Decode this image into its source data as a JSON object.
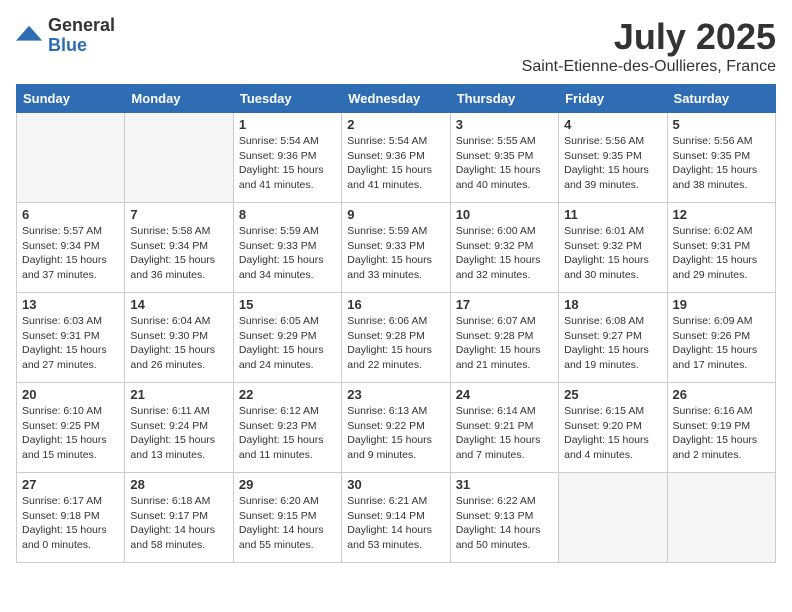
{
  "header": {
    "logo_general": "General",
    "logo_blue": "Blue",
    "month": "July 2025",
    "location": "Saint-Etienne-des-Oullieres, France"
  },
  "weekdays": [
    "Sunday",
    "Monday",
    "Tuesday",
    "Wednesday",
    "Thursday",
    "Friday",
    "Saturday"
  ],
  "weeks": [
    [
      {
        "day": "",
        "empty": true
      },
      {
        "day": "",
        "empty": true
      },
      {
        "day": "1",
        "info": "Sunrise: 5:54 AM\nSunset: 9:36 PM\nDaylight: 15 hours\nand 41 minutes."
      },
      {
        "day": "2",
        "info": "Sunrise: 5:54 AM\nSunset: 9:36 PM\nDaylight: 15 hours\nand 41 minutes."
      },
      {
        "day": "3",
        "info": "Sunrise: 5:55 AM\nSunset: 9:35 PM\nDaylight: 15 hours\nand 40 minutes."
      },
      {
        "day": "4",
        "info": "Sunrise: 5:56 AM\nSunset: 9:35 PM\nDaylight: 15 hours\nand 39 minutes."
      },
      {
        "day": "5",
        "info": "Sunrise: 5:56 AM\nSunset: 9:35 PM\nDaylight: 15 hours\nand 38 minutes."
      }
    ],
    [
      {
        "day": "6",
        "info": "Sunrise: 5:57 AM\nSunset: 9:34 PM\nDaylight: 15 hours\nand 37 minutes."
      },
      {
        "day": "7",
        "info": "Sunrise: 5:58 AM\nSunset: 9:34 PM\nDaylight: 15 hours\nand 36 minutes."
      },
      {
        "day": "8",
        "info": "Sunrise: 5:59 AM\nSunset: 9:33 PM\nDaylight: 15 hours\nand 34 minutes."
      },
      {
        "day": "9",
        "info": "Sunrise: 5:59 AM\nSunset: 9:33 PM\nDaylight: 15 hours\nand 33 minutes."
      },
      {
        "day": "10",
        "info": "Sunrise: 6:00 AM\nSunset: 9:32 PM\nDaylight: 15 hours\nand 32 minutes."
      },
      {
        "day": "11",
        "info": "Sunrise: 6:01 AM\nSunset: 9:32 PM\nDaylight: 15 hours\nand 30 minutes."
      },
      {
        "day": "12",
        "info": "Sunrise: 6:02 AM\nSunset: 9:31 PM\nDaylight: 15 hours\nand 29 minutes."
      }
    ],
    [
      {
        "day": "13",
        "info": "Sunrise: 6:03 AM\nSunset: 9:31 PM\nDaylight: 15 hours\nand 27 minutes."
      },
      {
        "day": "14",
        "info": "Sunrise: 6:04 AM\nSunset: 9:30 PM\nDaylight: 15 hours\nand 26 minutes."
      },
      {
        "day": "15",
        "info": "Sunrise: 6:05 AM\nSunset: 9:29 PM\nDaylight: 15 hours\nand 24 minutes."
      },
      {
        "day": "16",
        "info": "Sunrise: 6:06 AM\nSunset: 9:28 PM\nDaylight: 15 hours\nand 22 minutes."
      },
      {
        "day": "17",
        "info": "Sunrise: 6:07 AM\nSunset: 9:28 PM\nDaylight: 15 hours\nand 21 minutes."
      },
      {
        "day": "18",
        "info": "Sunrise: 6:08 AM\nSunset: 9:27 PM\nDaylight: 15 hours\nand 19 minutes."
      },
      {
        "day": "19",
        "info": "Sunrise: 6:09 AM\nSunset: 9:26 PM\nDaylight: 15 hours\nand 17 minutes."
      }
    ],
    [
      {
        "day": "20",
        "info": "Sunrise: 6:10 AM\nSunset: 9:25 PM\nDaylight: 15 hours\nand 15 minutes."
      },
      {
        "day": "21",
        "info": "Sunrise: 6:11 AM\nSunset: 9:24 PM\nDaylight: 15 hours\nand 13 minutes."
      },
      {
        "day": "22",
        "info": "Sunrise: 6:12 AM\nSunset: 9:23 PM\nDaylight: 15 hours\nand 11 minutes."
      },
      {
        "day": "23",
        "info": "Sunrise: 6:13 AM\nSunset: 9:22 PM\nDaylight: 15 hours\nand 9 minutes."
      },
      {
        "day": "24",
        "info": "Sunrise: 6:14 AM\nSunset: 9:21 PM\nDaylight: 15 hours\nand 7 minutes."
      },
      {
        "day": "25",
        "info": "Sunrise: 6:15 AM\nSunset: 9:20 PM\nDaylight: 15 hours\nand 4 minutes."
      },
      {
        "day": "26",
        "info": "Sunrise: 6:16 AM\nSunset: 9:19 PM\nDaylight: 15 hours\nand 2 minutes."
      }
    ],
    [
      {
        "day": "27",
        "info": "Sunrise: 6:17 AM\nSunset: 9:18 PM\nDaylight: 15 hours\nand 0 minutes."
      },
      {
        "day": "28",
        "info": "Sunrise: 6:18 AM\nSunset: 9:17 PM\nDaylight: 14 hours\nand 58 minutes."
      },
      {
        "day": "29",
        "info": "Sunrise: 6:20 AM\nSunset: 9:15 PM\nDaylight: 14 hours\nand 55 minutes."
      },
      {
        "day": "30",
        "info": "Sunrise: 6:21 AM\nSunset: 9:14 PM\nDaylight: 14 hours\nand 53 minutes."
      },
      {
        "day": "31",
        "info": "Sunrise: 6:22 AM\nSunset: 9:13 PM\nDaylight: 14 hours\nand 50 minutes."
      },
      {
        "day": "",
        "empty": true
      },
      {
        "day": "",
        "empty": true
      }
    ]
  ]
}
